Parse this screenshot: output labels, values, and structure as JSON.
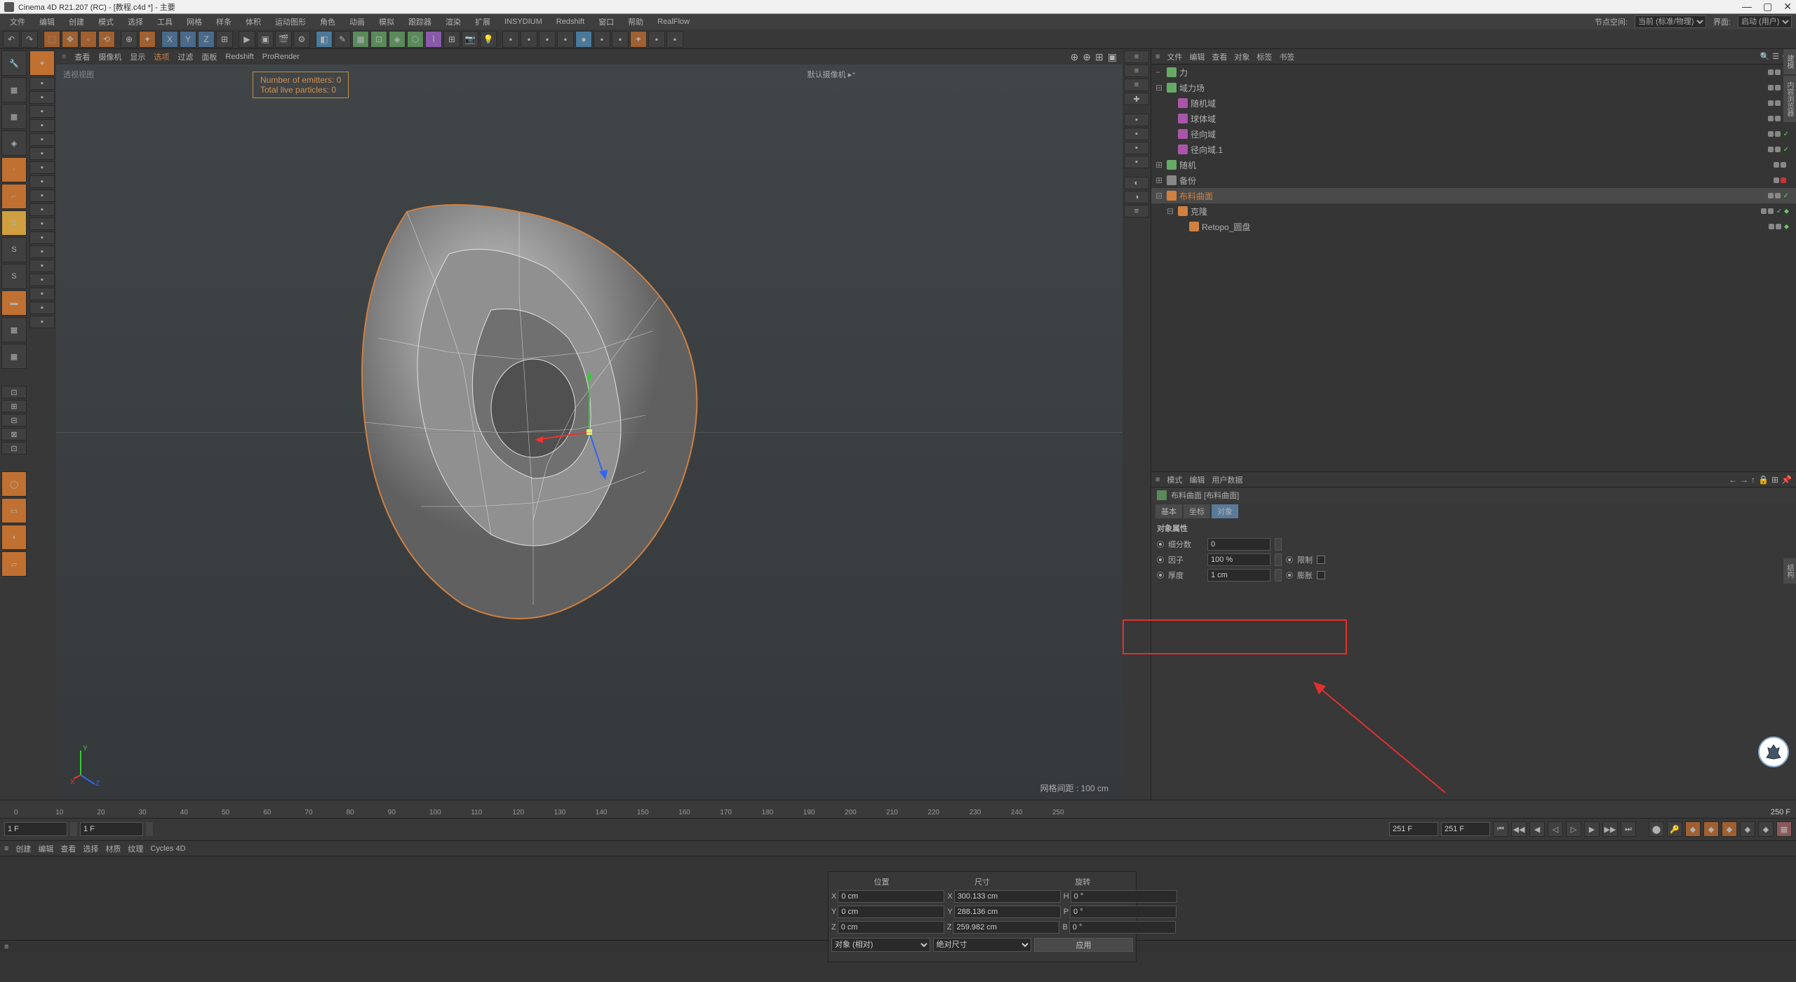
{
  "title": "Cinema 4D R21.207 (RC) - [教程.c4d *] - 主要",
  "menubar": {
    "items": [
      "文件",
      "编辑",
      "创建",
      "模式",
      "选择",
      "工具",
      "网格",
      "样条",
      "体积",
      "运动图形",
      "角色",
      "动画",
      "模拟",
      "跟踪器",
      "渲染",
      "扩展",
      "INSYDIUM",
      "Redshift",
      "窗口",
      "帮助",
      "RealFlow"
    ],
    "node_space_label": "节点空间:",
    "node_space_value": "当前 (标准/物理)",
    "layout_label": "界面:",
    "layout_value": "启动 (用户)"
  },
  "viewport_menu": {
    "items": [
      "查看",
      "摄像机",
      "显示",
      "选项",
      "过滤",
      "面板",
      "Redshift",
      "ProRender"
    ]
  },
  "viewport": {
    "top_left": "透视视图",
    "emitters": "Number of emitters: 0",
    "particles": "Total live particles: 0",
    "camera": "默认摄像机",
    "grid": "网格间距 : 100 cm",
    "axis": {
      "x": "X",
      "y": "Y",
      "z": "Z"
    }
  },
  "right_panel_menu": {
    "items": [
      "文件",
      "编辑",
      "查看",
      "对象",
      "标签",
      "书签"
    ]
  },
  "objects": [
    {
      "name": "力",
      "indent": 0,
      "color": "#6a6",
      "toggle": "−",
      "dots": [
        "#888",
        "#888"
      ],
      "tag": "✓"
    },
    {
      "name": "域力场",
      "indent": 0,
      "color": "#6a6",
      "toggle": "⊟",
      "dots": [
        "#888",
        "#888"
      ],
      "tag": "✓"
    },
    {
      "name": "随机域",
      "indent": 1,
      "color": "#a5a",
      "toggle": "",
      "dots": [
        "#888",
        "#888"
      ],
      "tag": "✓"
    },
    {
      "name": "球体域",
      "indent": 1,
      "color": "#a5a",
      "toggle": "",
      "dots": [
        "#888",
        "#888"
      ],
      "tag": "✓"
    },
    {
      "name": "径向域",
      "indent": 1,
      "color": "#a5a",
      "toggle": "",
      "dots": [
        "#888",
        "#888"
      ],
      "tag": "✓"
    },
    {
      "name": "径向域.1",
      "indent": 1,
      "color": "#a5a",
      "toggle": "",
      "dots": [
        "#888",
        "#888"
      ],
      "tag": "✓"
    },
    {
      "name": "随机",
      "indent": 0,
      "color": "#6a6",
      "toggle": "⊞",
      "dots": [
        "#888",
        "#888"
      ],
      "tag": ""
    },
    {
      "name": "备份",
      "indent": 0,
      "color": "#888",
      "toggle": "⊞",
      "dots": [
        "#888",
        "#c33"
      ],
      "tag": ""
    },
    {
      "name": "布料曲面",
      "indent": 0,
      "color": "#d08040",
      "toggle": "⊟",
      "dots": [
        "#888",
        "#888"
      ],
      "tag": "✓",
      "sel": true
    },
    {
      "name": "克隆",
      "indent": 1,
      "color": "#d08040",
      "toggle": "⊟",
      "dots": [
        "#888",
        "#888"
      ],
      "tag": "✓ ⬥"
    },
    {
      "name": "Retopo_圆盘",
      "indent": 2,
      "color": "#d08040",
      "toggle": "",
      "dots": [
        "#888",
        "#888"
      ],
      "tag": "⬥"
    }
  ],
  "attr_menu": {
    "items": [
      "模式",
      "编辑",
      "用户数据"
    ]
  },
  "attr_header": "布料曲面 [布料曲面]",
  "attr_tabs": [
    "基本",
    "坐标",
    "对象"
  ],
  "attr_section": "对象属性",
  "attr_rows": {
    "subdiv_label": "细分数",
    "subdiv_val": "0",
    "factor_label": "因子",
    "factor_val": "100 %",
    "limit_label": "限制",
    "thick_label": "厚度",
    "thick_val": "1 cm",
    "bulge_label": "膨胀"
  },
  "timeline": {
    "ticks": [
      "0",
      "10",
      "20",
      "30",
      "40",
      "50",
      "60",
      "70",
      "80",
      "90",
      "100",
      "110",
      "120",
      "130",
      "140",
      "150",
      "160",
      "170",
      "180",
      "190",
      "200",
      "210",
      "220",
      "230",
      "240",
      "250"
    ],
    "end": "250 F",
    "start_frame": "1 F",
    "cur_frame": "1 F",
    "total1": "251 F",
    "total2": "251 F"
  },
  "bottom_menu": {
    "items": [
      "创建",
      "编辑",
      "查看",
      "选择",
      "材质",
      "纹理",
      "Cycles 4D"
    ]
  },
  "coord": {
    "headers": [
      "位置",
      "尺寸",
      "旋转"
    ],
    "rows": [
      {
        "axis": "X",
        "pos": "0 cm",
        "size": "300.133 cm",
        "rot_label": "H",
        "rot": "0 °"
      },
      {
        "axis": "Y",
        "pos": "0 cm",
        "size": "288.136 cm",
        "rot_label": "P",
        "rot": "0 °"
      },
      {
        "axis": "Z",
        "pos": "0 cm",
        "size": "259.982 cm",
        "rot_label": "B",
        "rot": "0 °"
      }
    ],
    "mode1": "对象 (相对)",
    "mode2": "绝对尺寸",
    "apply": "应用"
  },
  "edge_tabs": [
    "建模",
    "内容浏览器",
    "结构"
  ]
}
